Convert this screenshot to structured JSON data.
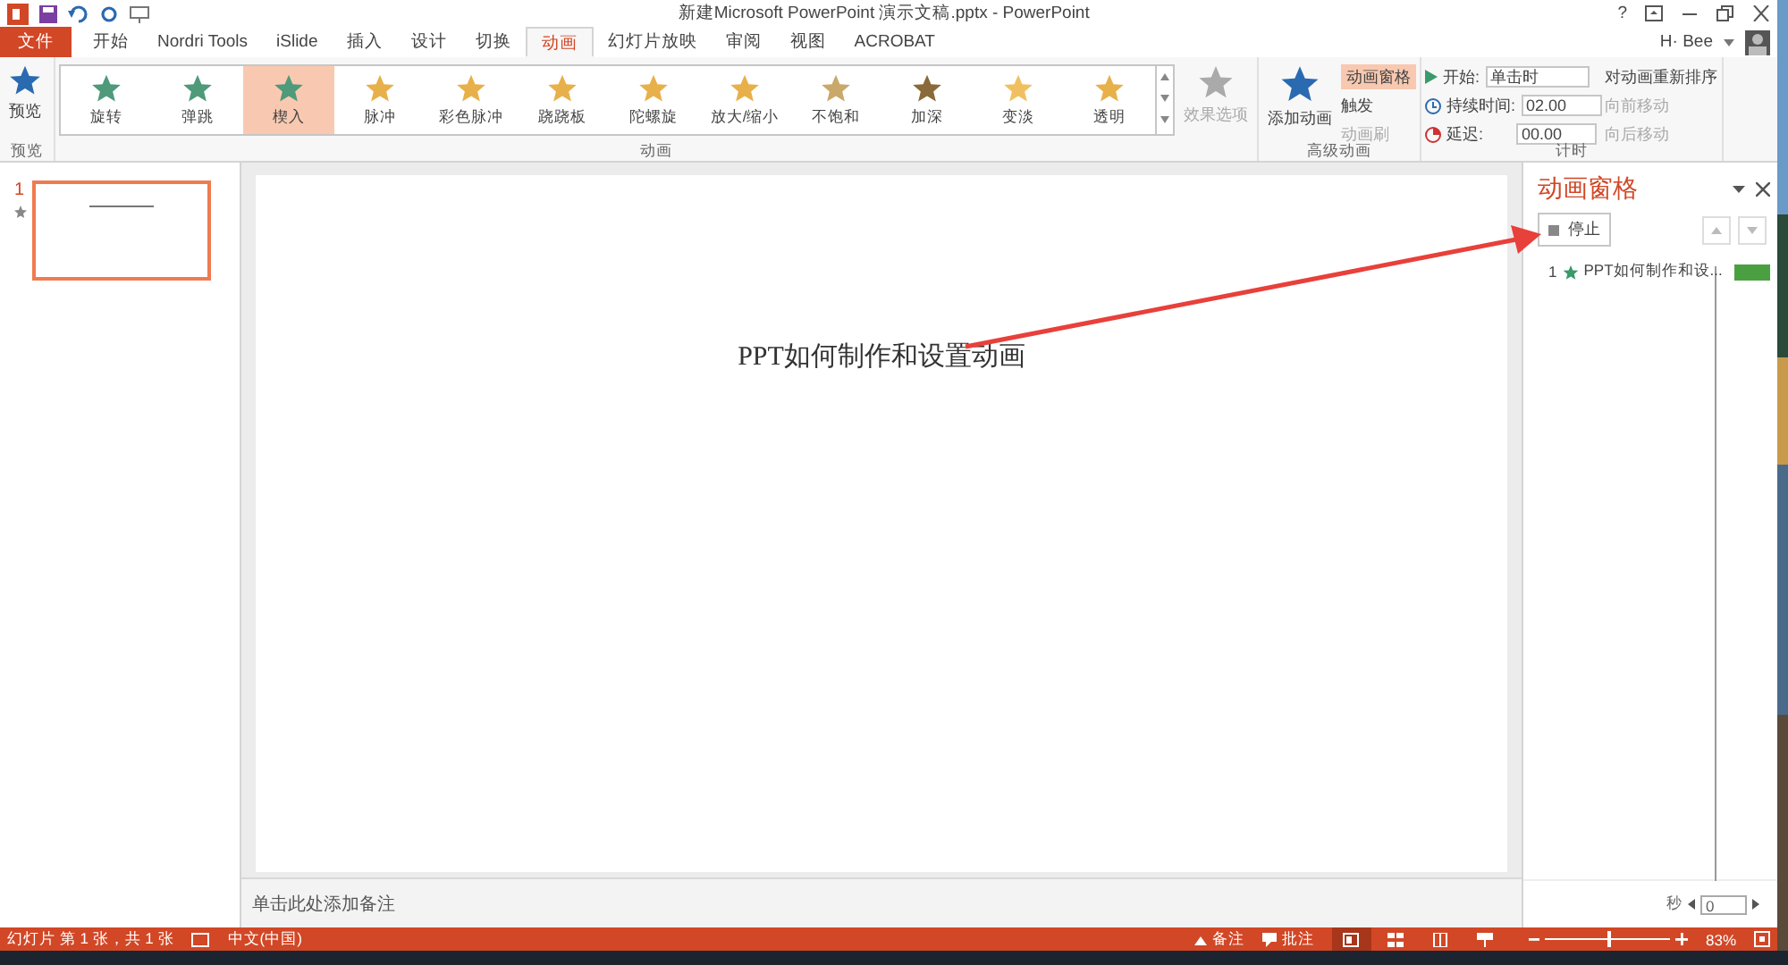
{
  "window": {
    "title": "新建Microsoft PowerPoint 演示文稿.pptx - PowerPoint",
    "help": "?",
    "user": "H· Bee"
  },
  "tabs": [
    {
      "label": "文件",
      "kind": "file",
      "selected": false
    },
    {
      "label": "开始",
      "kind": "tab",
      "selected": false
    },
    {
      "label": "Nordri Tools",
      "kind": "tab",
      "selected": false
    },
    {
      "label": "iSlide",
      "kind": "tab",
      "selected": false
    },
    {
      "label": "插入",
      "kind": "tab",
      "selected": false
    },
    {
      "label": "设计",
      "kind": "tab",
      "selected": false
    },
    {
      "label": "切换",
      "kind": "tab",
      "selected": false
    },
    {
      "label": "动画",
      "kind": "tab",
      "selected": true
    },
    {
      "label": "幻灯片放映",
      "kind": "tab",
      "selected": false
    },
    {
      "label": "审阅",
      "kind": "tab",
      "selected": false
    },
    {
      "label": "视图",
      "kind": "tab",
      "selected": false
    },
    {
      "label": "ACROBAT",
      "kind": "tab",
      "selected": false
    }
  ],
  "ribbon": {
    "preview": {
      "label": "预览",
      "group": "预览"
    },
    "gallery": {
      "group": "动画",
      "items": [
        {
          "label": "旋转",
          "color": "#4e9a7a",
          "selected": false
        },
        {
          "label": "弹跳",
          "color": "#4e9a7a",
          "selected": false
        },
        {
          "label": "楔入",
          "color": "#4e9a7a",
          "selected": true
        },
        {
          "label": "脉冲",
          "color": "#e8b04a",
          "selected": false
        },
        {
          "label": "彩色脉冲",
          "color": "#e8b04a",
          "selected": false
        },
        {
          "label": "跷跷板",
          "color": "#e8b04a",
          "selected": false
        },
        {
          "label": "陀螺旋",
          "color": "#e8b04a",
          "selected": false
        },
        {
          "label": "放大/缩小",
          "color": "#e8b04a",
          "selected": false
        },
        {
          "label": "不饱和",
          "color": "#c9a86a",
          "selected": false
        },
        {
          "label": "加深",
          "color": "#8a6a3a",
          "selected": false
        },
        {
          "label": "变淡",
          "color": "#f0c060",
          "selected": false
        },
        {
          "label": "透明",
          "color": "#e8b04a",
          "selected": false
        }
      ]
    },
    "effect_options": {
      "label": "效果选项",
      "disabled": true
    },
    "advanced": {
      "group": "高级动画",
      "add": "添加动画",
      "pane": {
        "label": "动画窗格",
        "selected": true
      },
      "trigger": {
        "label": "触发",
        "disabled": false
      },
      "painter": {
        "label": "动画刷",
        "disabled": true
      }
    },
    "timing": {
      "group": "计时",
      "start_label": "开始:",
      "start_value": "单击时",
      "duration_label": "持续时间:",
      "duration": "02.00",
      "delay_label": "延迟:",
      "delay": "00.00",
      "reorder": "对动画重新排序",
      "moves": [
        {
          "label": "向前移动",
          "disabled": true
        },
        {
          "label": "向后移动",
          "disabled": true
        }
      ]
    }
  },
  "slides": [
    {
      "number": "1",
      "selected": true
    }
  ],
  "slide": {
    "title": "PPT如何制作和设置动画"
  },
  "notes": {
    "placeholder": "单击此处添加备注"
  },
  "pane": {
    "title": "动画窗格",
    "play": "停止",
    "items": [
      {
        "number": "1",
        "label": "PPT如何制作和设..."
      }
    ],
    "unit": "秒",
    "scale": "0"
  },
  "status": {
    "slide": "幻灯片 第 1 张，共 1 张",
    "language": "中文(中国)",
    "notes": "备注",
    "comments": "批注",
    "views": [
      {
        "kind": "normal",
        "selected": true
      },
      {
        "kind": "sorter",
        "selected": false
      },
      {
        "kind": "reading",
        "selected": false
      },
      {
        "kind": "show",
        "selected": false
      }
    ],
    "zoom": {
      "level": 0.5,
      "reading": "83%"
    }
  }
}
